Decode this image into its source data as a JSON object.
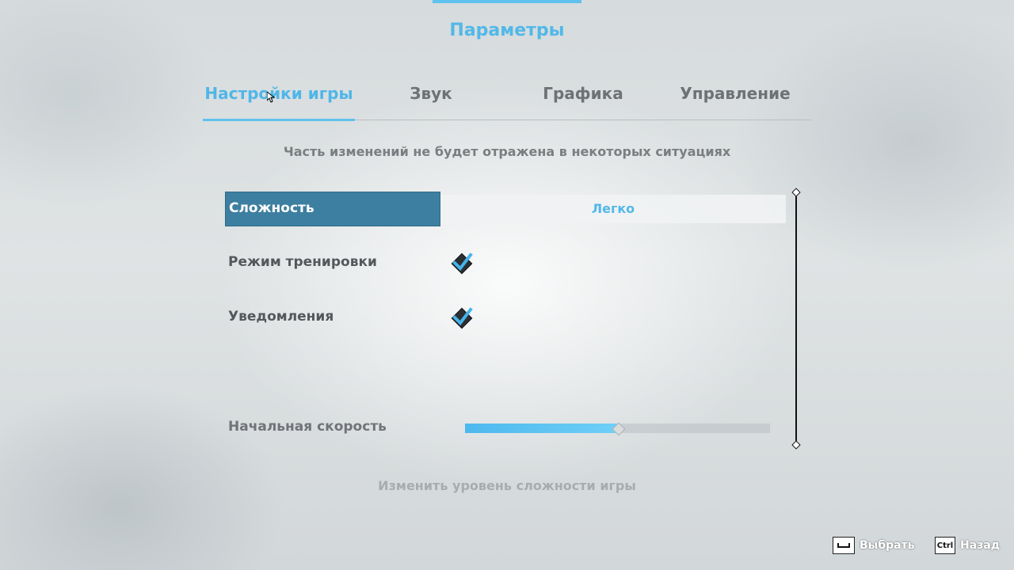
{
  "header": {
    "title": "Параметры"
  },
  "tabs": [
    {
      "label": "Настройки игры",
      "active": true
    },
    {
      "label": "Звук",
      "active": false
    },
    {
      "label": "Графика",
      "active": false
    },
    {
      "label": "Управление",
      "active": false
    }
  ],
  "notice": "Часть изменений не будет отражена в некоторых ситуациях",
  "settings": {
    "difficulty": {
      "label": "Сложность",
      "value": "Легко"
    },
    "training_mode": {
      "label": "Режим тренировки",
      "checked": true
    },
    "notifications": {
      "label": "Уведомления",
      "checked": true
    },
    "start_speed": {
      "label": "Начальная скорость",
      "level": 0.5
    }
  },
  "hint": "Изменить уровень сложности игры",
  "footer": {
    "select": {
      "key": "space-key-icon",
      "label": "Выбрать"
    },
    "back": {
      "key": "Ctrl",
      "label": "Назад"
    }
  },
  "colors": {
    "accent": "#5fc2ee",
    "selected_row": "#3d7fa0"
  }
}
